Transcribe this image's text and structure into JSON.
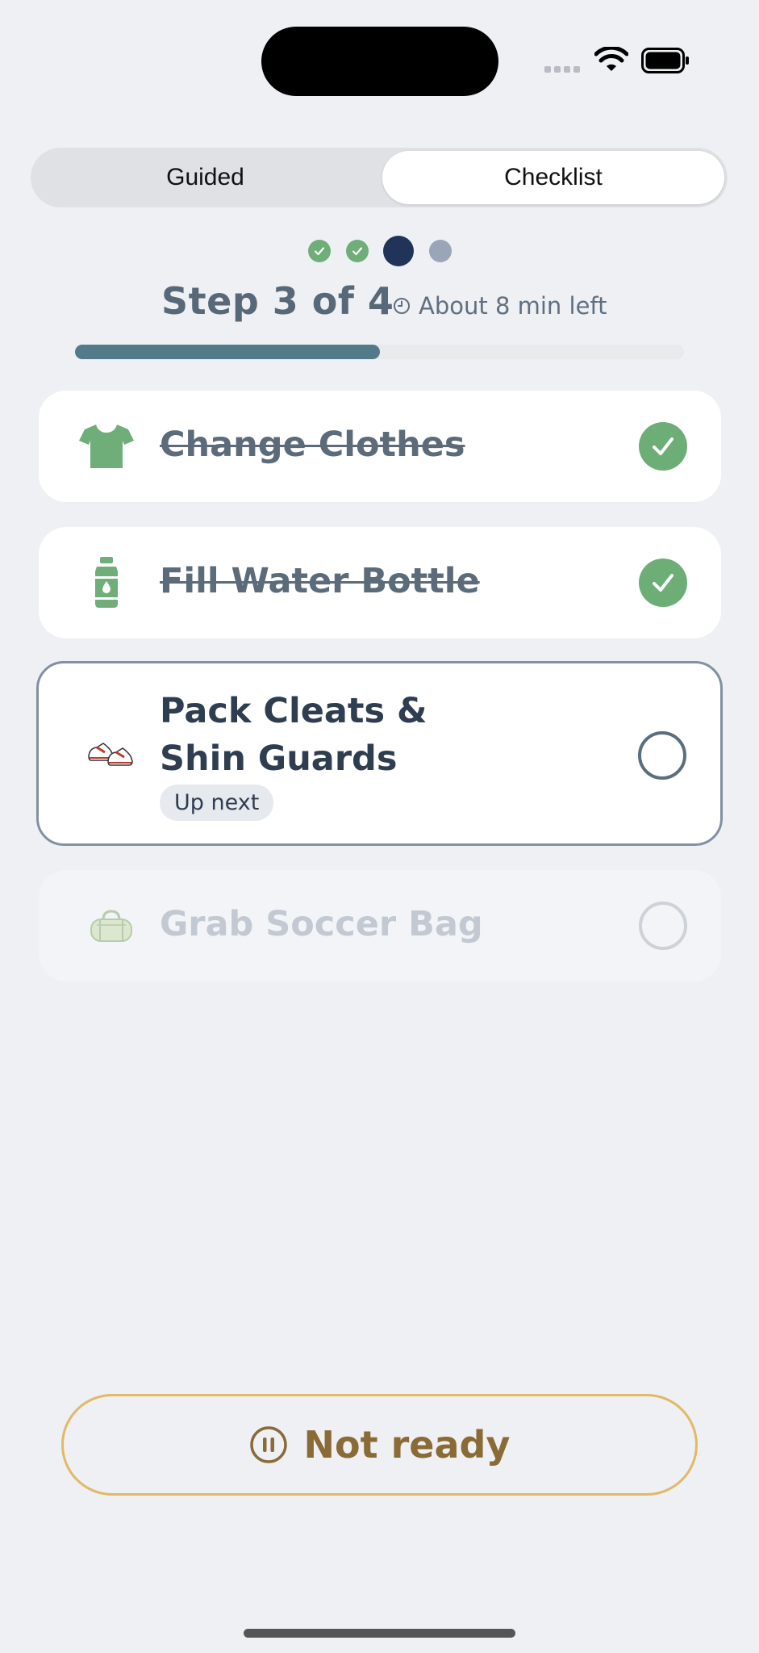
{
  "tabs": {
    "guided": "Guided",
    "checklist": "Checklist",
    "selected": "Checklist"
  },
  "progress": {
    "step_text": "Step 3 of 4",
    "time_left": "About 8 min left",
    "current_step": 3,
    "total_steps": 4,
    "fraction_complete": 0.5
  },
  "tasks": [
    {
      "label": "Change Clothes",
      "icon": "shirt-icon",
      "status": "done"
    },
    {
      "label": "Fill Water Bottle",
      "icon": "water-bottle-icon",
      "status": "done"
    },
    {
      "label_line1": "Pack Cleats &",
      "label_line2": "Shin Guards",
      "icon": "cleats-icon",
      "status": "current",
      "badge": "Up next"
    },
    {
      "label": "Grab Soccer Bag",
      "icon": "duffel-bag-icon",
      "status": "pending"
    }
  ],
  "footer": {
    "not_ready_label": "Not ready",
    "icon": "pause-icon"
  },
  "colors": {
    "done_green": "#6cae76",
    "current_navy": "#1f3458",
    "progress_fill": "#527a89",
    "not_ready_border": "#e3b866",
    "not_ready_text": "#8a6a35"
  }
}
